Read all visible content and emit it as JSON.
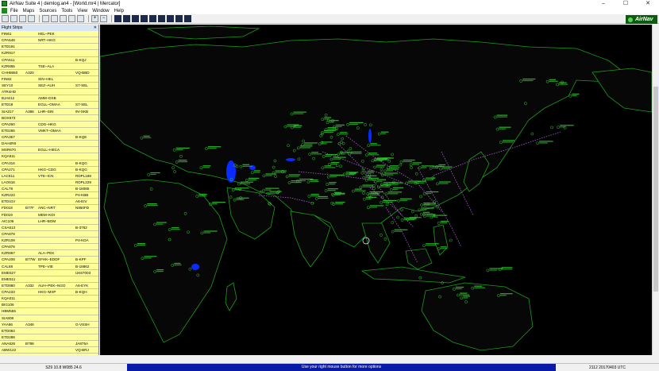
{
  "window": {
    "title": "AirNav Suite 4 | demlog.an4 - [World.mr4 | Mercator]",
    "controls": [
      "–",
      "☐",
      "✕"
    ]
  },
  "menu": [
    "File",
    "Maps",
    "Sources",
    "Tools",
    "View",
    "Window",
    "Help"
  ],
  "toolbar": {
    "icons": [
      "new-icon",
      "open-icon",
      "save-icon",
      "print-icon",
      "globe-icon",
      "globe-icon",
      "globe-icon",
      "layers-icon",
      "map-icon",
      "plus-icon",
      "minus-icon",
      "monitor-icon",
      "panel-icon",
      "panel-icon",
      "panel-icon",
      "panel-icon",
      "panel-icon",
      "panel-icon",
      "panel-icon",
      "panel-icon"
    ]
  },
  "brand": {
    "label": "AirNav",
    "color": "#0b5d0b"
  },
  "flight_strips": {
    "title": "Flight Strips",
    "close": "✕",
    "rows": [
      {
        "cs": "FIN61",
        "type": "",
        "route": "HEL–PEK",
        "reg": ""
      },
      {
        "cs": "CPA548",
        "type": "",
        "route": "NRT–HKG",
        "reg": ""
      },
      {
        "cs": "ETD191",
        "type": "",
        "route": "",
        "reg": ""
      },
      {
        "cs": "KZR917",
        "type": "",
        "route": "",
        "reg": ""
      },
      {
        "cs": "CPA611",
        "type": "",
        "route": "",
        "reg": "B-KQJ"
      },
      {
        "cs": "KZR855",
        "type": "",
        "route": "TSE–ALA",
        "reg": ""
      },
      {
        "cs": "CHH8650",
        "type": "A320",
        "route": "",
        "reg": "VQ-BBD"
      },
      {
        "cs": "FIN82",
        "type": "",
        "route": "SIN–HEL",
        "reg": ""
      },
      {
        "cs": "SEY10",
        "type": "",
        "route": "SEZ–AUH",
        "reg": "S7-SEL"
      },
      {
        "cs": "ATR4HD",
        "type": "",
        "route": "",
        "reg": ""
      },
      {
        "cs": "BJA612",
        "type": "",
        "route": "AMM–DXB",
        "reg": ""
      },
      {
        "cs": "ETD18",
        "type": "",
        "route": "EGLL–OMAA",
        "reg": "S7-SEL"
      },
      {
        "cs": "SIA317",
        "type": "A388",
        "route": "LHR–SIN",
        "reg": "9V-SKB"
      },
      {
        "cs": "BOX673",
        "type": "",
        "route": "",
        "reg": ""
      },
      {
        "cs": "CPA260",
        "type": "",
        "route": "CDG–HKG",
        "reg": ""
      },
      {
        "cs": "ETD265",
        "type": "",
        "route": "VMKT–OMAA",
        "reg": ""
      },
      {
        "cs": "CPA357",
        "type": "",
        "route": "",
        "reg": "B-KQE"
      },
      {
        "cs": "DAH4R6",
        "type": "",
        "route": "",
        "reg": ""
      },
      {
        "cs": "MSR670",
        "type": "",
        "route": "EGLL–HECA",
        "reg": ""
      },
      {
        "cs": "KQA511",
        "type": "",
        "route": "",
        "reg": ""
      },
      {
        "cs": "CPA316",
        "type": "",
        "route": "",
        "reg": "B-KQG"
      },
      {
        "cs": "CPA271",
        "type": "",
        "route": "HKG–CDG",
        "reg": "B-KQG"
      },
      {
        "cs": "LAC611",
        "type": "",
        "route": "VTE–ICN",
        "reg": "RDPL188"
      },
      {
        "cs": "LAO616",
        "type": "",
        "route": "",
        "reg": "RDPL229"
      },
      {
        "cs": "CAL78",
        "type": "",
        "route": "",
        "reg": "B-18085"
      },
      {
        "cs": "KZR223",
        "type": "",
        "route": "",
        "reg": "P4-KBB"
      },
      {
        "cs": "ETD41V",
        "type": "",
        "route": "",
        "reg": "A6-EIV"
      },
      {
        "cs": "FD018",
        "type": "B77F",
        "route": "ANC–NRT",
        "reg": "N850FD"
      },
      {
        "cs": "FD019",
        "type": "",
        "route": "MEM–KDI",
        "reg": ""
      },
      {
        "cs": "AIC106",
        "type": "",
        "route": "LHR–BOM",
        "reg": ""
      },
      {
        "cs": "CSA613",
        "type": "",
        "route": "",
        "reg": "B-3762"
      },
      {
        "cs": "CPA878",
        "type": "",
        "route": "",
        "reg": ""
      },
      {
        "cs": "KZR109",
        "type": "",
        "route": "",
        "reg": "P4-KDA"
      },
      {
        "cs": "CPA876",
        "type": "",
        "route": "",
        "reg": ""
      },
      {
        "cs": "KZR867",
        "type": "",
        "route": "ALA–PEK",
        "reg": ""
      },
      {
        "cs": "CPA208",
        "type": "B77W",
        "route": "EFHK–EDDF",
        "reg": "B-KPF"
      },
      {
        "cs": "CAL68",
        "type": "",
        "route": "TPE–VIE",
        "reg": "B-18862"
      },
      {
        "cs": "EME527",
        "type": "",
        "route": "",
        "reg": "UK67003"
      },
      {
        "cs": "EME511",
        "type": "",
        "route": "",
        "reg": ""
      },
      {
        "cs": "ETD880",
        "type": "A332",
        "route": "AUH–PEK–NGO",
        "reg": "A6-EYK"
      },
      {
        "cs": "CPA233",
        "type": "",
        "route": "HKG–MXP",
        "reg": "B-KQH"
      },
      {
        "cs": "KQA011",
        "type": "",
        "route": "",
        "reg": ""
      },
      {
        "cs": "BIG106",
        "type": "",
        "route": "",
        "reg": ""
      },
      {
        "cs": "HBM555",
        "type": "",
        "route": "",
        "reg": ""
      },
      {
        "cs": "SIA808",
        "type": "",
        "route": "",
        "reg": ""
      },
      {
        "cs": "YAA86",
        "type": "A346",
        "route": "",
        "reg": "G-VSSH"
      },
      {
        "cs": "ETD084",
        "type": "",
        "route": "",
        "reg": ""
      },
      {
        "cs": "ETD288",
        "type": "",
        "route": "",
        "reg": ""
      },
      {
        "cs": "ANA626",
        "type": "B788",
        "route": "",
        "reg": "JA875A"
      },
      {
        "cs": "ABW122",
        "type": "",
        "route": "",
        "reg": "VQ-BRJ"
      },
      {
        "cs": "SIA306",
        "type": "A388",
        "route": "",
        "reg": "9V-SKC"
      },
      {
        "cs": "KQA304",
        "type": "",
        "route": "",
        "reg": "5Y-CYC"
      },
      {
        "cs": "PFS2981",
        "type": "A320",
        "route": "",
        "reg": "RPC868"
      },
      {
        "cs": "ETH784",
        "type": "",
        "route": "LFPG–EBBR",
        "reg": ""
      },
      {
        "cs": "PFS2989",
        "type": "",
        "route": "",
        "reg": "RPC8989"
      }
    ],
    "selected_index": 52
  },
  "status": {
    "position": "S29 10.8 W085 24.6",
    "hint": "Use your right mouse button for more options",
    "clock": "2112 20170403 UTC"
  },
  "map": {
    "background": "#000000",
    "land_color": "#070707",
    "coast_color": "#1c9c1c",
    "label_color": "#2fd02f",
    "track_color": "#b05cd8"
  }
}
